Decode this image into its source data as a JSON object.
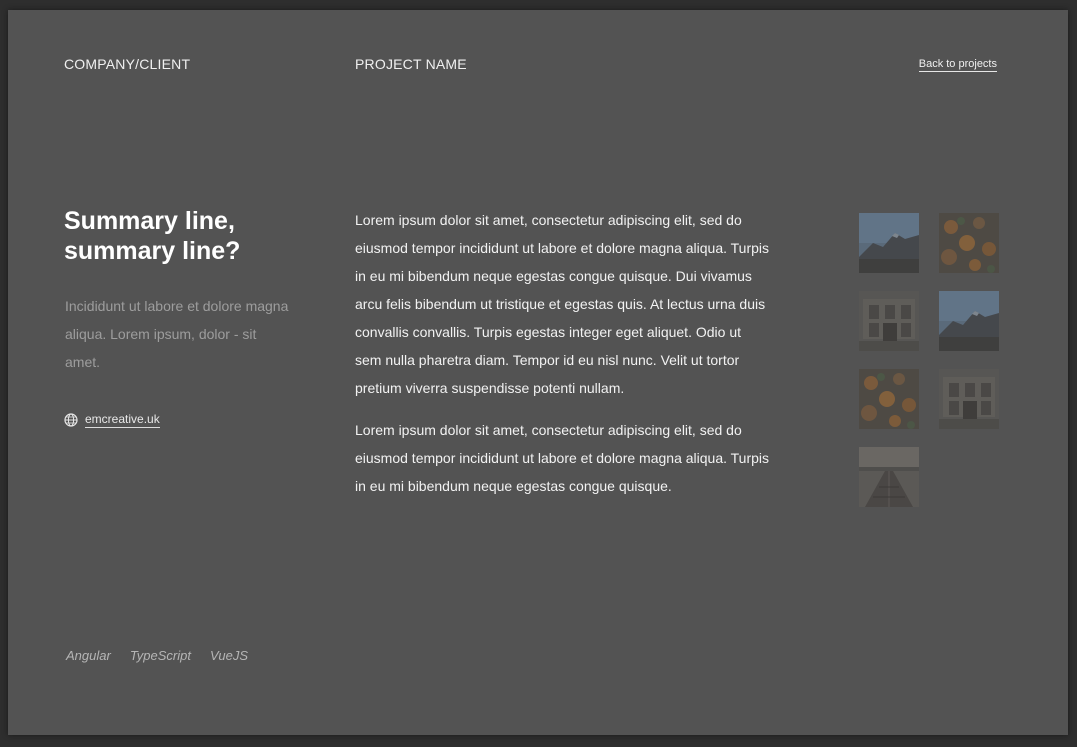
{
  "header": {
    "company": "COMPANY/CLIENT",
    "project": "PROJECT NAME",
    "back_link": "Back to projects"
  },
  "summary": {
    "title": "Summary line, summary line?",
    "subtitle": "Incididunt ut labore et dolore magna aliqua. Lorem ipsum, dolor - sit amet.",
    "website": "emcreative.uk",
    "website_icon": "globe-icon"
  },
  "body": {
    "paragraphs": [
      "Lorem ipsum dolor sit amet, consectetur adipiscing elit, sed do eiusmod tempor incididunt ut labore et dolore magna aliqua. Turpis in eu mi bibendum neque egestas congue quisque. Dui vivamus arcu felis bibendum ut tristique et egestas quis. At lectus urna duis convallis convallis. Turpis egestas integer eget aliquet. Odio ut sem nulla pharetra diam. Tempor id eu nisl nunc. Velit ut tortor pretium viverra suspendisse potenti nullam.",
      "Lorem ipsum dolor sit amet, consectetur adipiscing elit, sed do eiusmod tempor incididunt ut labore et dolore magna aliqua. Turpis in eu mi bibendum neque egestas congue quisque."
    ]
  },
  "gallery": {
    "images": [
      "mountain",
      "autumn-leaves",
      "building",
      "mountain",
      "autumn-leaves",
      "building",
      "boardwalk"
    ]
  },
  "tags": [
    "Angular",
    "TypeScript",
    "VueJS"
  ],
  "colors": {
    "background": "#2e2e2e",
    "card": "#535353",
    "text": "#ffffff",
    "muted_text": "#9d9d9d"
  }
}
